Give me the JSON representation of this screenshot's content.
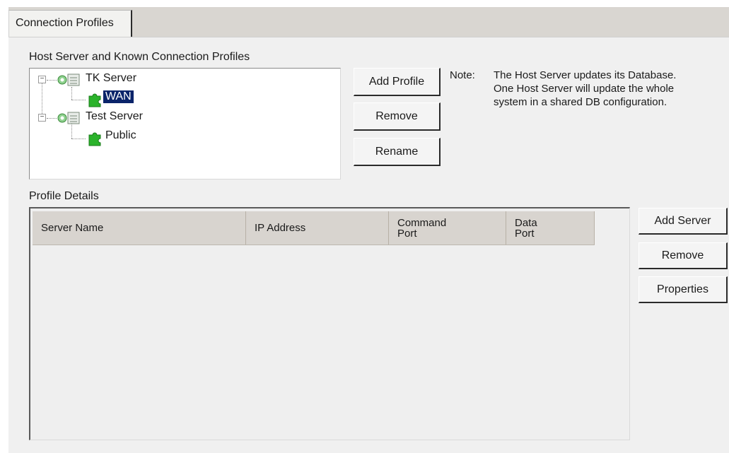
{
  "tab": {
    "label": "Connection Profiles"
  },
  "hosts_section": {
    "label": "Host Server and Known Connection Profiles"
  },
  "tree": {
    "nodes": [
      {
        "label": "TK Server",
        "type": "server",
        "expanded": true,
        "children": [
          {
            "label": "WAN",
            "type": "profile",
            "selected": true
          }
        ]
      },
      {
        "label": "Test Server",
        "type": "server",
        "expanded": true,
        "children": [
          {
            "label": "Public",
            "type": "profile",
            "selected": false
          }
        ]
      }
    ],
    "expander_symbol": "−"
  },
  "profile_buttons": {
    "add": "Add Profile",
    "remove": "Remove",
    "rename": "Rename"
  },
  "note": {
    "label": "Note:",
    "line1": "The Host Server updates its Database.",
    "line2": "One Host Server will update the whole",
    "line3": "system in a shared DB configuration."
  },
  "details_section": {
    "label": "Profile Details"
  },
  "table": {
    "columns": [
      {
        "line1": "Server Name",
        "line2": ""
      },
      {
        "line1": "IP Address",
        "line2": ""
      },
      {
        "line1": "Command",
        "line2": "Port"
      },
      {
        "line1": "Data",
        "line2": "Port"
      }
    ],
    "rows": []
  },
  "server_buttons": {
    "add": "Add Server",
    "remove": "Remove",
    "properties": "Properties"
  },
  "colors": {
    "selection": "#0a246a",
    "panel": "#f0f0f0",
    "header": "#d8d4cf",
    "puzzle_green": "#2bb32b"
  }
}
